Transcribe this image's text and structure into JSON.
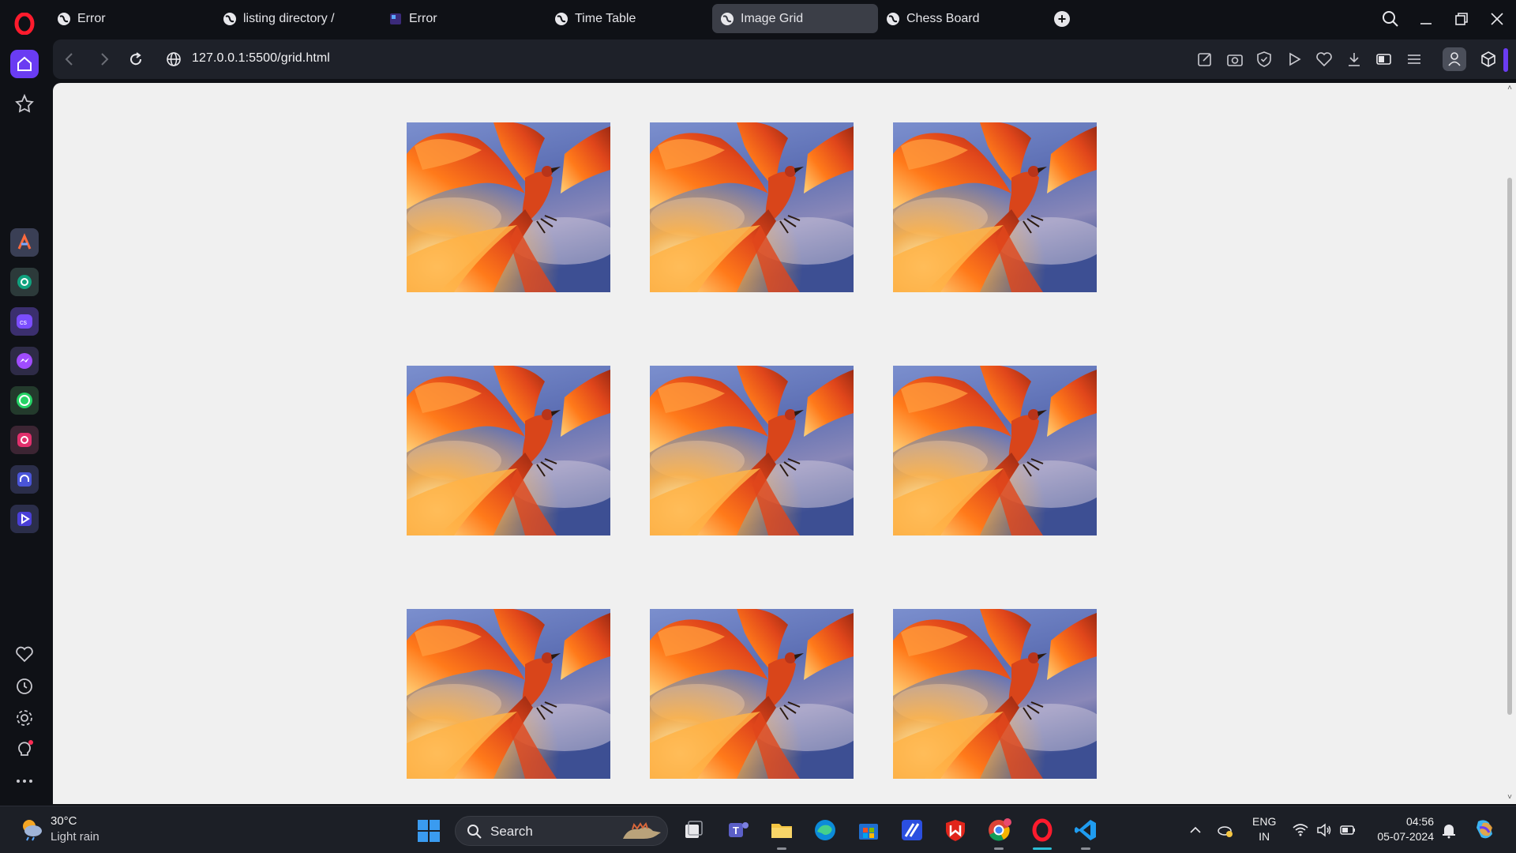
{
  "browser": {
    "tabs": [
      {
        "label": "Error",
        "favicon": "globe-icon"
      },
      {
        "label": "listing directory /",
        "favicon": "globe-icon"
      },
      {
        "label": "Error",
        "favicon": "vscode-favicon-icon"
      },
      {
        "label": "Time Table",
        "favicon": "globe-icon"
      },
      {
        "label": "Image Grid",
        "favicon": "globe-icon",
        "active": true
      },
      {
        "label": "Chess Board",
        "favicon": "globe-icon"
      }
    ],
    "url": "127.0.0.1:5500/grid.html",
    "accent_color": "#6a3cf2"
  },
  "page": {
    "background": "#f0f0f0",
    "grid": {
      "rows": 3,
      "columns": 3,
      "image_subject": "phoenix"
    }
  },
  "taskbar": {
    "weather": {
      "temperature": "30°C",
      "condition": "Light rain"
    },
    "search_placeholder": "Search",
    "language": {
      "line1": "ENG",
      "line2": "IN"
    },
    "clock": {
      "time": "04:56",
      "date": "05-07-2024"
    }
  }
}
